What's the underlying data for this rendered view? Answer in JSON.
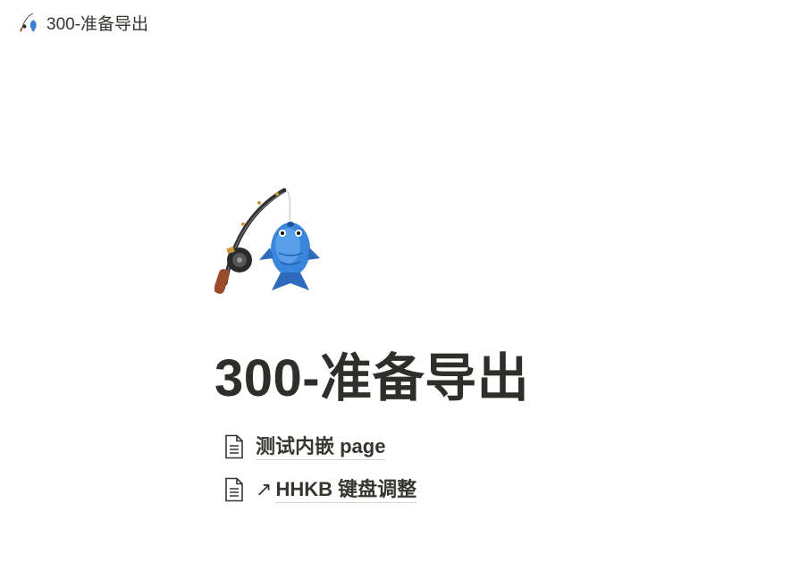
{
  "app": {
    "accent": "#37352f",
    "background": "#ffffff"
  },
  "breadcrumb": {
    "icon": "fishing-pole-icon",
    "title": "300-准备导出"
  },
  "page": {
    "icon": "fishing-pole-icon",
    "title": "300-准备导出"
  },
  "links": [
    {
      "icon": "page-icon",
      "arrow": "",
      "label": "测试内嵌 page"
    },
    {
      "icon": "page-icon",
      "arrow": "↗",
      "label": "HHKB 键盘调整"
    }
  ]
}
